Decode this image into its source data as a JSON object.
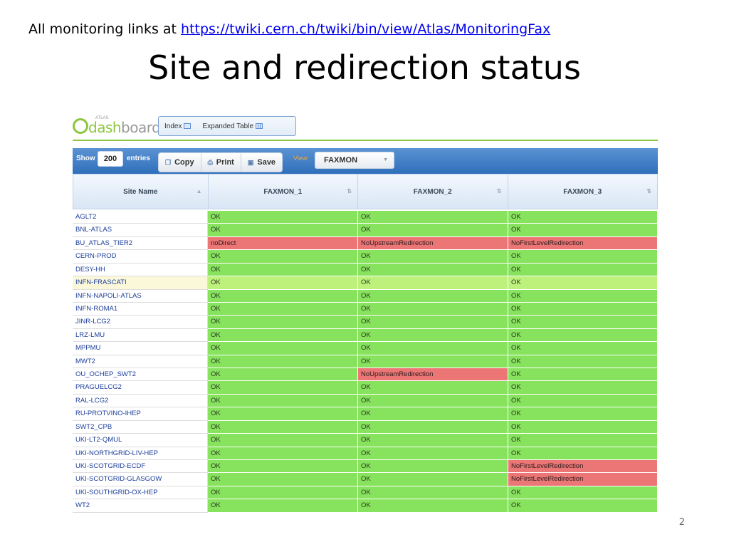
{
  "header": {
    "prefix": "All monitoring links at ",
    "link": "https://twiki.cern.ch/twiki/bin/view/Atlas/MonitoringFax",
    "title": "Site and redirection status"
  },
  "dashboard": {
    "logo_small": "ATLAS",
    "logo_dash": "dash",
    "logo_board": "board",
    "tabs": [
      {
        "label": "Index"
      },
      {
        "label": "Expanded Table"
      }
    ]
  },
  "toolbar": {
    "show_label": "Show",
    "show_value": "200",
    "entries_label": "entries",
    "copy_label": "Copy",
    "print_label": "Print",
    "save_label": "Save",
    "view_label": "View:",
    "view_value": "FAXMON"
  },
  "table": {
    "columns": [
      "Site Name",
      "FAXMON_1",
      "FAXMON_2",
      "FAXMON_3"
    ],
    "rows": [
      {
        "site": "AGLT2",
        "v": [
          "OK",
          "OK",
          "OK"
        ]
      },
      {
        "site": "BNL-ATLAS",
        "v": [
          "OK",
          "OK",
          "OK"
        ]
      },
      {
        "site": "BU_ATLAS_TIER2",
        "v": [
          "noDirect",
          "NoUpstreamRedirection",
          "NoFirstLevelRedirection"
        ]
      },
      {
        "site": "CERN-PROD",
        "v": [
          "OK",
          "OK",
          "OK"
        ]
      },
      {
        "site": "DESY-HH",
        "v": [
          "OK",
          "OK",
          "OK"
        ]
      },
      {
        "site": "INFN-FRASCATI",
        "v": [
          "OK",
          "OK",
          "OK"
        ],
        "highlight": true
      },
      {
        "site": "INFN-NAPOLI-ATLAS",
        "v": [
          "OK",
          "OK",
          "OK"
        ]
      },
      {
        "site": "INFN-ROMA1",
        "v": [
          "OK",
          "OK",
          "OK"
        ]
      },
      {
        "site": "JINR-LCG2",
        "v": [
          "OK",
          "OK",
          "OK"
        ]
      },
      {
        "site": "LRZ-LMU",
        "v": [
          "OK",
          "OK",
          "OK"
        ]
      },
      {
        "site": "MPPMU",
        "v": [
          "OK",
          "OK",
          "OK"
        ]
      },
      {
        "site": "MWT2",
        "v": [
          "OK",
          "OK",
          "OK"
        ]
      },
      {
        "site": "OU_OCHEP_SWT2",
        "v": [
          "OK",
          "NoUpstreamRedirection",
          "OK"
        ]
      },
      {
        "site": "PRAGUELCG2",
        "v": [
          "OK",
          "OK",
          "OK"
        ]
      },
      {
        "site": "RAL-LCG2",
        "v": [
          "OK",
          "OK",
          "OK"
        ]
      },
      {
        "site": "RU-PROTVINO-IHEP",
        "v": [
          "OK",
          "OK",
          "OK"
        ]
      },
      {
        "site": "SWT2_CPB",
        "v": [
          "OK",
          "OK",
          "OK"
        ]
      },
      {
        "site": "UKI-LT2-QMUL",
        "v": [
          "OK",
          "OK",
          "OK"
        ]
      },
      {
        "site": "UKI-NORTHGRID-LIV-HEP",
        "v": [
          "OK",
          "OK",
          "OK"
        ]
      },
      {
        "site": "UKI-SCOTGRID-ECDF",
        "v": [
          "OK",
          "OK",
          "NoFirstLevelRedirection"
        ]
      },
      {
        "site": "UKI-SCOTGRID-GLASGOW",
        "v": [
          "OK",
          "OK",
          "NoFirstLevelRedirection"
        ]
      },
      {
        "site": "UKI-SOUTHGRID-OX-HEP",
        "v": [
          "OK",
          "OK",
          "OK"
        ]
      },
      {
        "site": "WT2",
        "v": [
          "OK",
          "OK",
          "OK"
        ]
      }
    ]
  },
  "colors": {
    "ok": "#87e25d",
    "bad": "#ec7676",
    "accent": "#8cc63f",
    "toolbar": "#3b7cc6"
  },
  "page_number": "2"
}
